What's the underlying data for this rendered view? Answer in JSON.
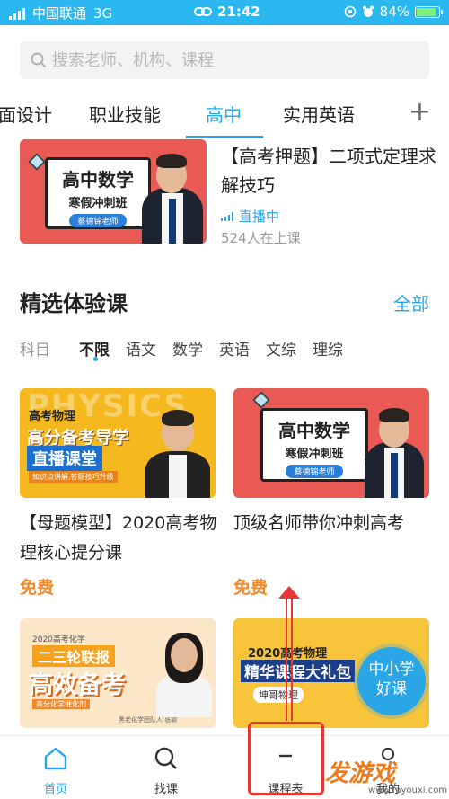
{
  "status_bar": {
    "carrier": "中国联通",
    "network": "3G",
    "time": "21:42",
    "battery": "84%"
  },
  "search": {
    "placeholder": "搜索老师、机构、课程"
  },
  "tabs": [
    {
      "label": "面设计"
    },
    {
      "label": "职业技能"
    },
    {
      "label": "高中"
    },
    {
      "label": "实用英语"
    }
  ],
  "live_course": {
    "poster_title": "高中数学",
    "poster_subtitle": "寒假冲刺班",
    "poster_teacher": "蔡德锦老师",
    "title": "【高考押题】二项式定理求解技巧",
    "status": "直播中",
    "viewers": "524人在上课"
  },
  "section": {
    "title": "精选体验课",
    "all_label": "全部"
  },
  "filters": [
    "科目",
    "不限",
    "语文",
    "数学",
    "英语",
    "文综",
    "理综"
  ],
  "courses": [
    {
      "poster_top": "高考物理",
      "poster_main": "高分备考导学",
      "poster_main2": "直播课堂",
      "poster_sub": "知识点讲解,答题技巧升级",
      "poster_bg_text": "PHYSICS",
      "title": "【母题模型】2020高考物理核心提分课",
      "price": "免费"
    },
    {
      "poster_title": "高中数学",
      "poster_subtitle": "寒假冲刺班",
      "poster_teacher": "蔡德锦老师",
      "title": "顶级名师带你冲刺高考",
      "price": "免费"
    },
    {
      "poster_top": "2020高考化学",
      "poster_main": "二三轮联报",
      "poster_main2": "高效备考",
      "poster_sub": "高分化学催化剂",
      "poster_teacher": "黑老化学团队人 张颖"
    },
    {
      "poster_top": "2020高考物理",
      "poster_main": "精华课程大礼包",
      "poster_sub": "坤哥物理"
    }
  ],
  "float_badge": {
    "line1": "中小学",
    "line2": "好课"
  },
  "nav": [
    {
      "label": "首页",
      "icon": "home-icon"
    },
    {
      "label": "找课",
      "icon": "search-icon"
    },
    {
      "label": "课程表",
      "icon": "schedule-icon"
    },
    {
      "label": "我的",
      "icon": "profile-icon"
    }
  ],
  "watermark": {
    "text": "发游戏",
    "url": "www.fayouxi.com"
  },
  "colors": {
    "accent": "#2aa5e6",
    "status_bar": "#2bb7f0",
    "price": "#f08a2c",
    "annotation": "#e53935"
  }
}
